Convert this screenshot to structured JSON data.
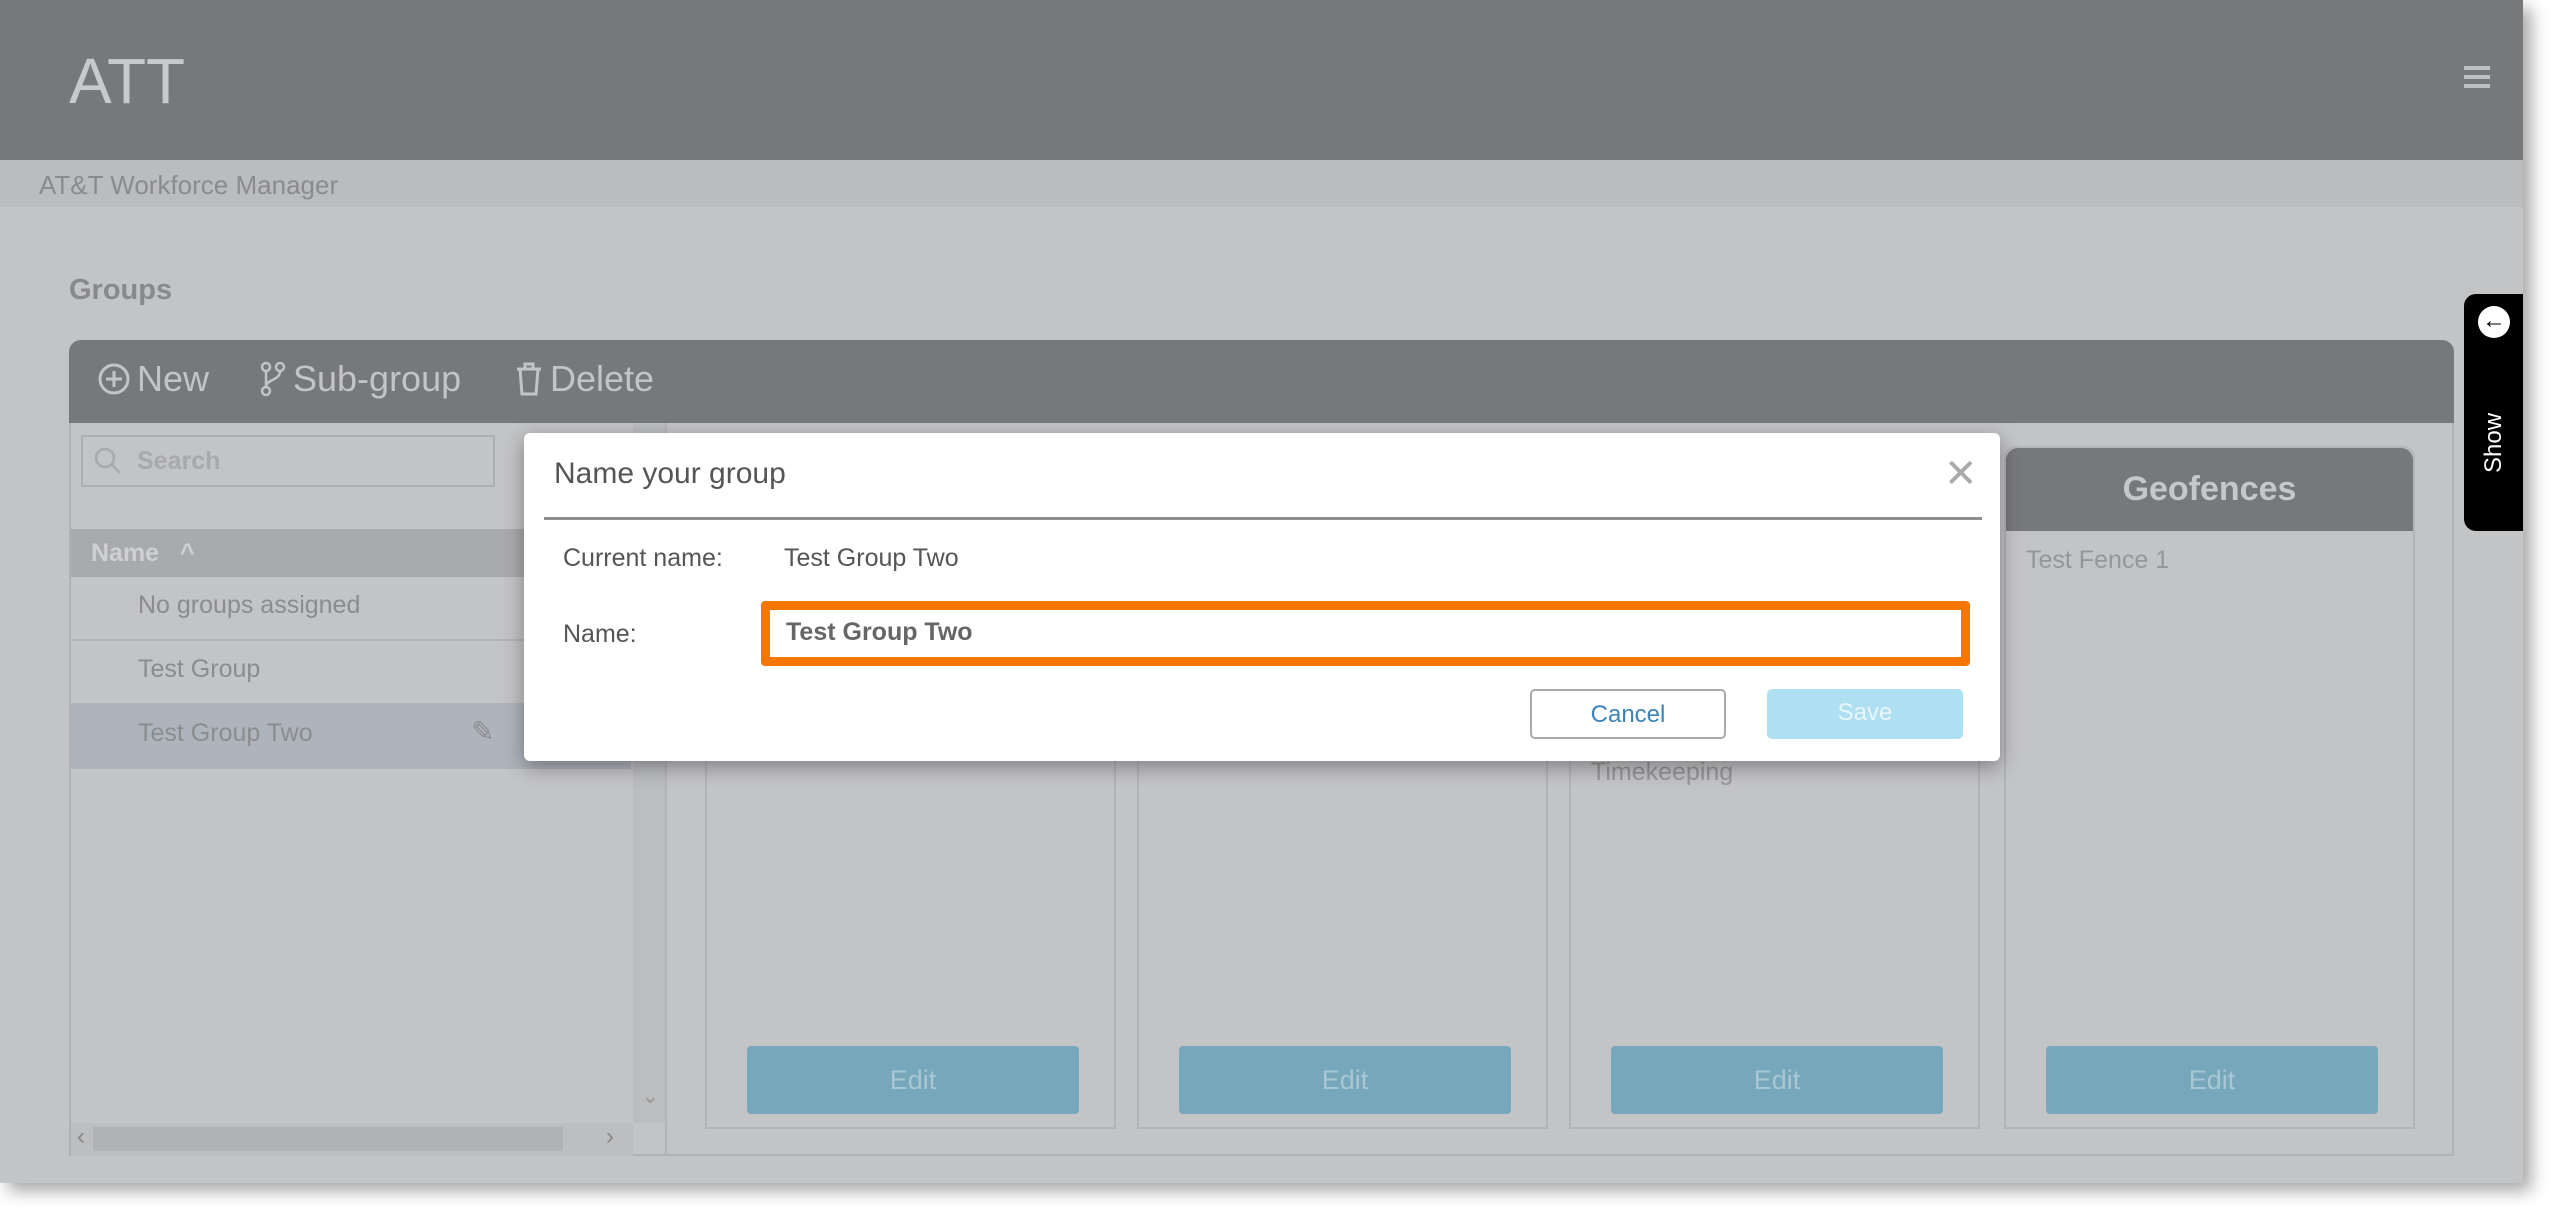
{
  "header": {
    "logo": "ATT",
    "menu_icon": "hamburger-icon"
  },
  "subheader": {
    "title": "AT&T Workforce Manager"
  },
  "page": {
    "title": "Groups"
  },
  "toolbar": {
    "new": "New",
    "subgroup": "Sub-group",
    "delete": "Delete"
  },
  "list": {
    "search_placeholder": "Search",
    "column": "Name",
    "rows": [
      "No groups assigned",
      "Test Group",
      "Test Group Two"
    ],
    "selected": "Test Group Two"
  },
  "cards": [
    {
      "title": "",
      "edit": "Edit"
    },
    {
      "title": "",
      "edit": "Edit"
    },
    {
      "title": "",
      "edit": "Edit",
      "items": [
        "Timekeeping"
      ]
    },
    {
      "title": "Geofences",
      "edit": "Edit",
      "items": [
        "Test Fence 1"
      ]
    }
  ],
  "show_tab": {
    "label": "Show"
  },
  "dialog": {
    "title": "Name your group",
    "current_label": "Current name:",
    "current_value": "Test Group Two",
    "name_label": "Name:",
    "name_value": "Test Group Two",
    "cancel": "Cancel",
    "save": "Save",
    "highlight_color": "#f57600"
  }
}
